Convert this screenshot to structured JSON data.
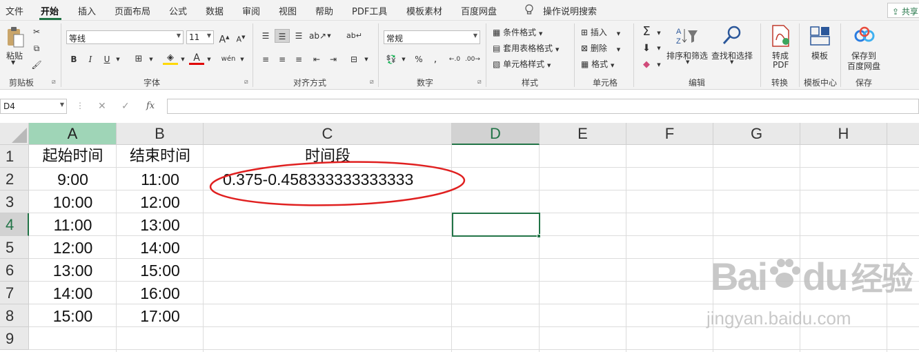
{
  "menu": {
    "items": [
      "文件",
      "开始",
      "插入",
      "页面布局",
      "公式",
      "数据",
      "审阅",
      "视图",
      "帮助",
      "PDF工具",
      "模板素材",
      "百度网盘"
    ],
    "active": "开始",
    "search": "操作说明搜索",
    "share": "共享"
  },
  "ribbon": {
    "clipboard": {
      "paste": "粘贴",
      "label": "剪贴板"
    },
    "font": {
      "name": "等线",
      "size": "11",
      "label": "字体"
    },
    "alignment": {
      "label": "对齐方式"
    },
    "number": {
      "format": "常规",
      "label": "数字",
      "percent": "%"
    },
    "styles": {
      "conditional": "条件格式",
      "table": "套用表格格式",
      "cell_styles": "单元格样式",
      "label": "样式"
    },
    "cells": {
      "insert": "插入",
      "delete": "删除",
      "format": "格式",
      "label": "单元格"
    },
    "editing": {
      "sort": "排序和筛选",
      "find": "查找和选择",
      "label": "编辑"
    },
    "convert": {
      "pdf_line1": "转成",
      "pdf_line2": "PDF",
      "label": "转换"
    },
    "template": {
      "btn": "模板",
      "label": "模板中心"
    },
    "save": {
      "line1": "保存到",
      "line2": "百度网盘",
      "label": "保存"
    }
  },
  "formula_bar": {
    "name_box": "D4",
    "fx": "fx",
    "formula": ""
  },
  "grid": {
    "columns": [
      "A",
      "B",
      "C",
      "D",
      "E",
      "F",
      "G",
      "H"
    ],
    "rows": [
      "1",
      "2",
      "3",
      "4",
      "5",
      "6",
      "7",
      "8",
      "9"
    ],
    "headers": {
      "a": "起始时间",
      "b": "结束时间",
      "c": "时间段"
    },
    "start_times": [
      "9:00",
      "10:00",
      "11:00",
      "12:00",
      "13:00",
      "14:00",
      "15:00"
    ],
    "end_times": [
      "11:00",
      "12:00",
      "13:00",
      "14:00",
      "15:00",
      "16:00",
      "17:00"
    ],
    "c2": "0.375-0.458333333333333",
    "active_cell": "D4",
    "annotation_color": "#e02020"
  },
  "watermark": {
    "brand": "Bai",
    "brand2": "du",
    "cn": "经验",
    "url": "jingyan.baidu.com"
  }
}
